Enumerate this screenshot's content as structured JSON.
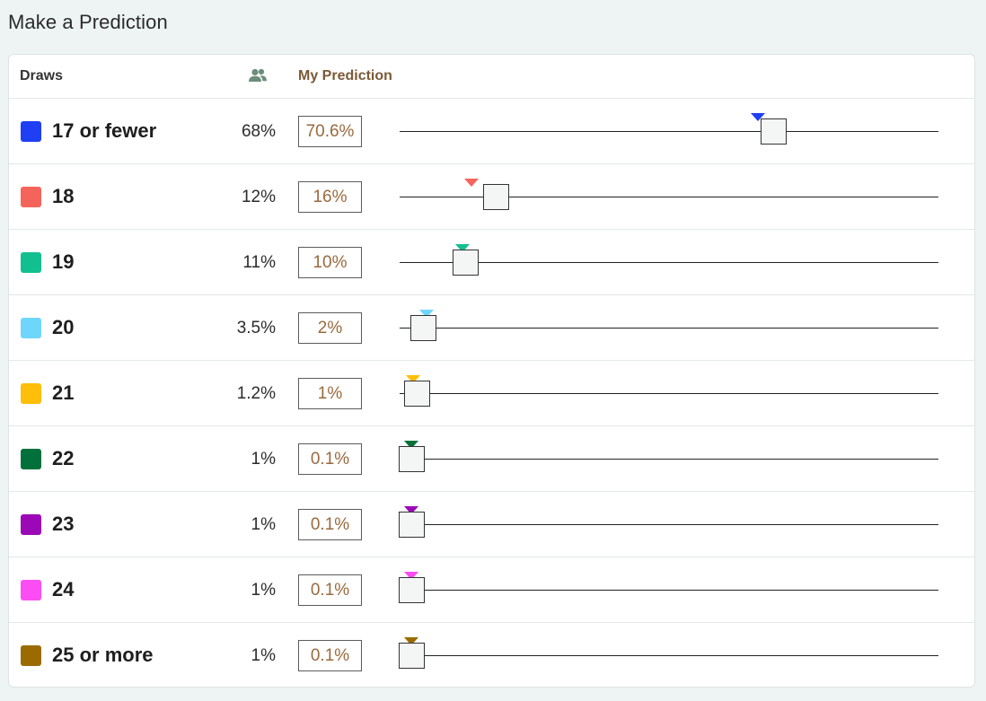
{
  "page_title": "Make a Prediction",
  "header": {
    "draws_label": "Draws",
    "community_icon": "users-icon",
    "my_prediction_label": "My Prediction",
    "community_icon_color": "#6b8e7b"
  },
  "rows": [
    {
      "label": "17 or fewer",
      "color": "#1f3ff5",
      "community_text": "68%",
      "community": 68,
      "prediction_text": "70.6%",
      "prediction": 70.6
    },
    {
      "label": "18",
      "color": "#f5645a",
      "community_text": "12%",
      "community": 12,
      "prediction_text": "16%",
      "prediction": 16
    },
    {
      "label": "19",
      "color": "#12c08f",
      "community_text": "11%",
      "community": 11,
      "prediction_text": "10%",
      "prediction": 10
    },
    {
      "label": "20",
      "color": "#6ed6fb",
      "community_text": "3.5%",
      "community": 3.5,
      "prediction_text": "2%",
      "prediction": 2
    },
    {
      "label": "21",
      "color": "#ffbe0a",
      "community_text": "1.2%",
      "community": 1.2,
      "prediction_text": "1%",
      "prediction": 1
    },
    {
      "label": "22",
      "color": "#02703a",
      "community_text": "1%",
      "community": 1,
      "prediction_text": "0.1%",
      "prediction": 0.1
    },
    {
      "label": "23",
      "color": "#9b09b6",
      "community_text": "1%",
      "community": 1,
      "prediction_text": "0.1%",
      "prediction": 0.1
    },
    {
      "label": "24",
      "color": "#fc4cf4",
      "community_text": "1%",
      "community": 1,
      "prediction_text": "0.1%",
      "prediction": 0.1
    },
    {
      "label": "25 or more",
      "color": "#9a6c00",
      "community_text": "1%",
      "community": 1,
      "prediction_text": "0.1%",
      "prediction": 0.1
    }
  ]
}
